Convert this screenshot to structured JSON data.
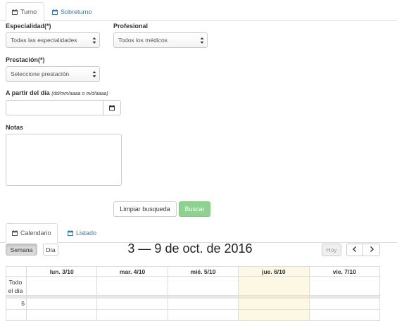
{
  "tabs": {
    "turno": "Turno",
    "sobreturno": "Sobreturno"
  },
  "form": {
    "especialidad_label": "Especialidad(*)",
    "especialidad_value": "Todas las especialidades",
    "profesional_label": "Profesional",
    "profesional_value": "Todos los médicos",
    "prestacion_label": "Prestación(*)",
    "prestacion_value": "Seleccione prestación",
    "fecha_label": "A partir del día",
    "fecha_hint": "(dd/mm/aaaa o m/d/aaaa)",
    "fecha_value": "",
    "notas_label": "Notas",
    "notas_value": "",
    "limpiar_label": "Limpiar busqueda",
    "buscar_label": "Buscar"
  },
  "view_tabs": {
    "calendario": "Calendario",
    "listado": "Listado"
  },
  "calendar": {
    "semana_label": "Semana",
    "dia_label": "Día",
    "title": "3 — 9 de oct. de 2016",
    "hoy_label": "Hoy",
    "prev_label": "<",
    "next_label": ">",
    "days": [
      "lun. 3/10",
      "mar. 4/10",
      "mié. 5/10",
      "jue. 6/10",
      "vie. 7/10"
    ],
    "all_day_label": "Todo el día",
    "first_hour": "6"
  },
  "colors": {
    "link": "#337ab7",
    "success": "#8fd18f",
    "today": "#fcf8e3"
  }
}
